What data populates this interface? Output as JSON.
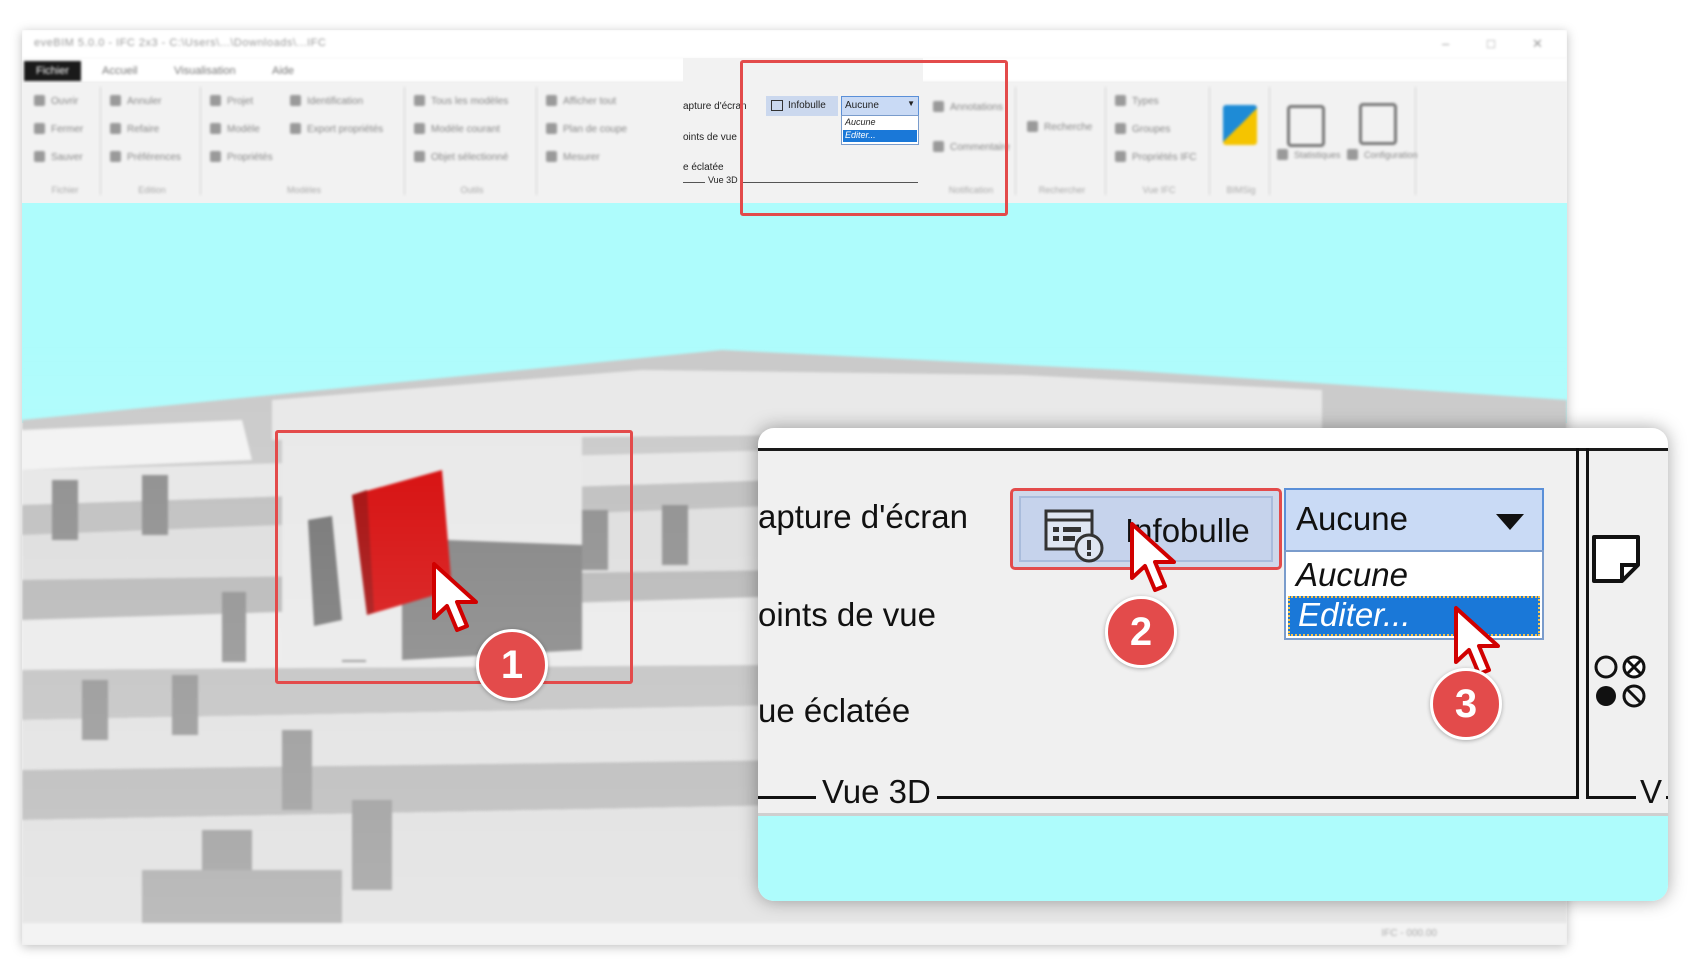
{
  "window": {
    "title": "eveBIM 5.0.0 - IFC 2x3 - C:\\Users\\...\\Downloads\\...IFC",
    "controls": [
      "–",
      "□",
      "✕"
    ]
  },
  "menu_tabs": [
    "Fichier",
    "Accueil",
    "Visualisation",
    "Aide"
  ],
  "ribbon": {
    "groups": [
      {
        "caption": "Fichier",
        "items": [
          "Ouvrir",
          "Fermer",
          "Sauver"
        ]
      },
      {
        "caption": "Edition",
        "items": [
          "Annuler",
          "Refaire",
          "Préférences"
        ]
      },
      {
        "caption": "Modèles",
        "items": [
          "Projet",
          "Modèle",
          "Propriétés",
          "Identification",
          "Export propriétés"
        ]
      },
      {
        "caption": "Outils",
        "items": [
          "Tous les modèles",
          "Modèle courant",
          "Objet sélectionné"
        ]
      },
      {
        "caption": "",
        "items": [
          "Afficher tout",
          "Plan de coupe",
          "Mesurer"
        ]
      },
      {
        "caption": "Notification",
        "items": [
          "Annotations",
          "Commentaire"
        ]
      },
      {
        "caption": "Rechercher",
        "items": [
          "Recherche"
        ]
      },
      {
        "caption": "Vue IFC",
        "items": [
          "Types",
          "Groupes",
          "Propriétés IFC"
        ]
      }
    ],
    "mini": {
      "capture": "apture d'écran",
      "points": "oints de vue",
      "eclatee": "e éclatée",
      "infobulle": "Infobulle",
      "combo_value": "Aucune",
      "options": [
        "Aucune",
        "Editer..."
      ],
      "group_caption": "Vue 3D"
    },
    "right_labels": [
      "BIMSig",
      "Statistiques",
      "Configuration"
    ]
  },
  "zoom": {
    "capture_label": "apture d'écran",
    "points_label": "oints de vue",
    "eclatee_label": "ue éclatée",
    "infobulle_label": "Infobulle",
    "combo_value": "Aucune",
    "dropdown_options": [
      "Aucune",
      "Editer..."
    ],
    "group_caption": "Vue 3D",
    "next_group_caption": "V"
  },
  "steps": [
    "1",
    "2",
    "3"
  ],
  "status_text": "IFC - 000.00",
  "colors": {
    "highlight": "#e34b4b",
    "sky": "#aefcfc",
    "selected_wall": "#d40000",
    "selection_blue": "#1a78d8",
    "combo_bg": "#c9daf5"
  },
  "icons": [
    "tooltip-icon",
    "dropdown-arrow-icon",
    "note-icon",
    "circles-icon",
    "cursor-icon"
  ]
}
